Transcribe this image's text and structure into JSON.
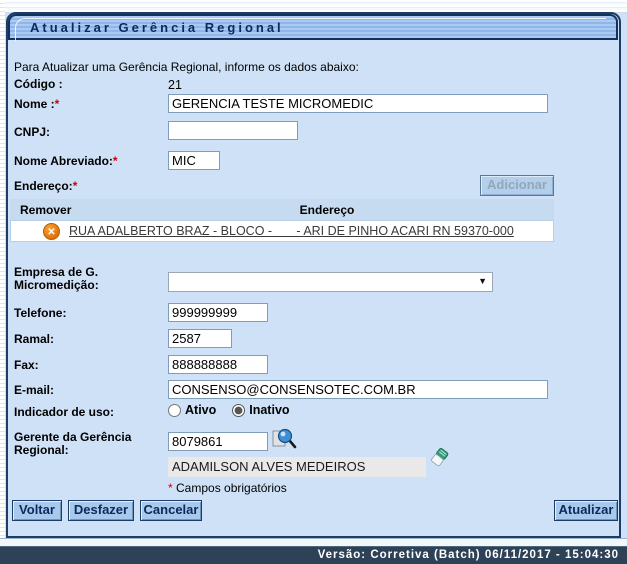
{
  "window": {
    "title_bar": "Atualizar Gerência Regional",
    "instruction": "Para Atualizar uma Gerência Regional, informe os dados abaixo:"
  },
  "fields": {
    "codigo": {
      "label": "Código :",
      "value": "21"
    },
    "nome": {
      "label": "Nome :",
      "required_mark": "*",
      "value": "GERENCIA TESTE MICROMEDIC"
    },
    "cnpj": {
      "label": "CNPJ:",
      "value": ""
    },
    "nome_abreviado": {
      "label": "Nome Abreviado:",
      "required_mark": "*",
      "value": "MIC"
    },
    "endereco": {
      "label": "Endereço:",
      "required_mark": "*"
    },
    "empresa_micromedicao": {
      "label": "Empresa de G. Micromedição:",
      "selected_value": ""
    },
    "telefone": {
      "label": "Telefone:",
      "value": "999999999"
    },
    "ramal": {
      "label": "Ramal:",
      "value": "2587"
    },
    "fax": {
      "label": "Fax:",
      "value": "888888888"
    },
    "email": {
      "label": "E-mail:",
      "value": "CONSENSO@CONSENSOTEC.COM.BR"
    },
    "indicador_uso": {
      "label": "Indicador de uso:",
      "options": [
        {
          "label": "Ativo"
        },
        {
          "label": "Inativo",
          "checked": "checked"
        }
      ]
    },
    "gerente": {
      "label": "Gerente da Gerência Regional:",
      "codigo_value": "8079861",
      "nome_value": "ADAMILSON ALVES MEDEIROS"
    }
  },
  "address_table": {
    "headers": {
      "remover": "Remover",
      "endereco": "Endereço"
    },
    "rows": [
      {
        "endereco_link": "RUA ADALBERTO BRAZ - BLOCO -       - ARI DE PINHO ACARI RN 59370-000"
      }
    ]
  },
  "required_note": {
    "mark": "*",
    "text": " Campos obrigatórios"
  },
  "buttons": {
    "adicionar": "Adicionar",
    "voltar": "Voltar",
    "desfazer": "Desfazer",
    "cancelar": "Cancelar",
    "atualizar": "Atualizar"
  },
  "icons": {
    "remove_glyph": "✕",
    "dropdown_glyph": "▼"
  },
  "footer": {
    "version": "Versão: Corretiva (Batch) 06/11/2017 - 15:04:30"
  },
  "colors": {
    "page_bg": "#cfe1f6",
    "title_text": "#0a2a5e",
    "title_border": "#13315c",
    "table_header_bg": "#c6dbf0",
    "remove_icon_bg": "#e0720d",
    "required_mark": "#cc0000",
    "button_bg": "#a9c9ec",
    "footer_bg": "#2e4257"
  }
}
